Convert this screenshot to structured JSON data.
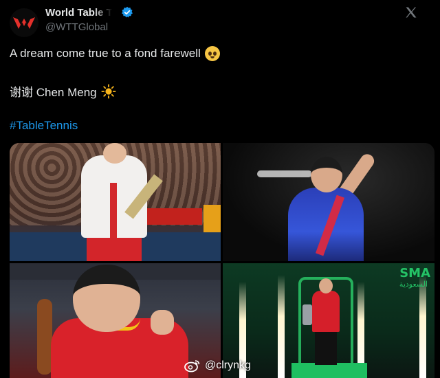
{
  "author": {
    "display_name": "World Table T",
    "handle": "@WTTGlobal",
    "verified": true
  },
  "post": {
    "line1": "A dream come true to a fond farewell",
    "line2": "谢谢 Chen Meng",
    "hashtag": "#TableTennis"
  },
  "media": {
    "sponsor_text": "SMA",
    "sponsor_arabic": "السعودية"
  },
  "watermark": {
    "text": "@clrynkg"
  },
  "icons": {
    "avatar_logo": "wtt-logo-icon",
    "verified": "verified-badge-icon",
    "platform": "x-logo-icon",
    "emoji1": "pleading-face-emoji",
    "emoji2": "sun-emoji",
    "watermark": "weibo-icon"
  },
  "colors": {
    "background": "#000000",
    "text": "#e7e9ea",
    "secondary": "#71767b",
    "link": "#1d9bf0",
    "verified": "#1d9bf0",
    "logo_red": "#e4302b"
  }
}
